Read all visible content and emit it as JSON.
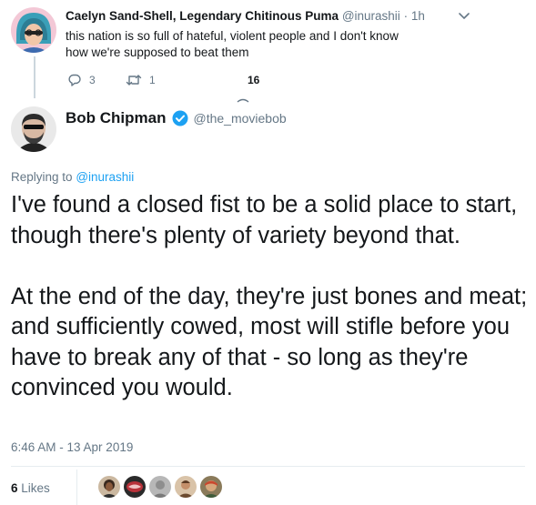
{
  "parent_tweet": {
    "name": "Caelyn Sand-Shell, Legendary Chitinous Puma",
    "handle": "@inurashii",
    "time": "· 1h",
    "text": "this nation is so full of hateful, violent people and I don't know how we're supposed to beat them",
    "reply_count": "3",
    "retweet_count": "1",
    "like_count": "16",
    "icons": {
      "reply": "reply-icon",
      "retweet": "retweet-icon",
      "like": "like-icon",
      "menu": "chevron-down-icon"
    }
  },
  "main_tweet": {
    "name": "Bob Chipman",
    "handle": "@the_moviebob",
    "verified": true,
    "replying_prefix": "Replying to",
    "replying_handle": "@inurashii",
    "paragraph1": "I've found a closed fist to be a solid place to start, though there's plenty of variety beyond that.",
    "paragraph2": "At the end of the day, they're just bones and meat; and sufficiently cowed, most will stifle before you have to break any of that - so long as they're convinced you would.",
    "timestamp": "6:46 AM - 13 Apr 2019",
    "likes_count": "6",
    "likes_label": "Likes",
    "liker_avatars": 5
  },
  "colors": {
    "text": "#14171a",
    "secondary": "#657786",
    "link": "#1da1f2",
    "verified": "#1da1f2",
    "border": "#e6ecf0"
  }
}
